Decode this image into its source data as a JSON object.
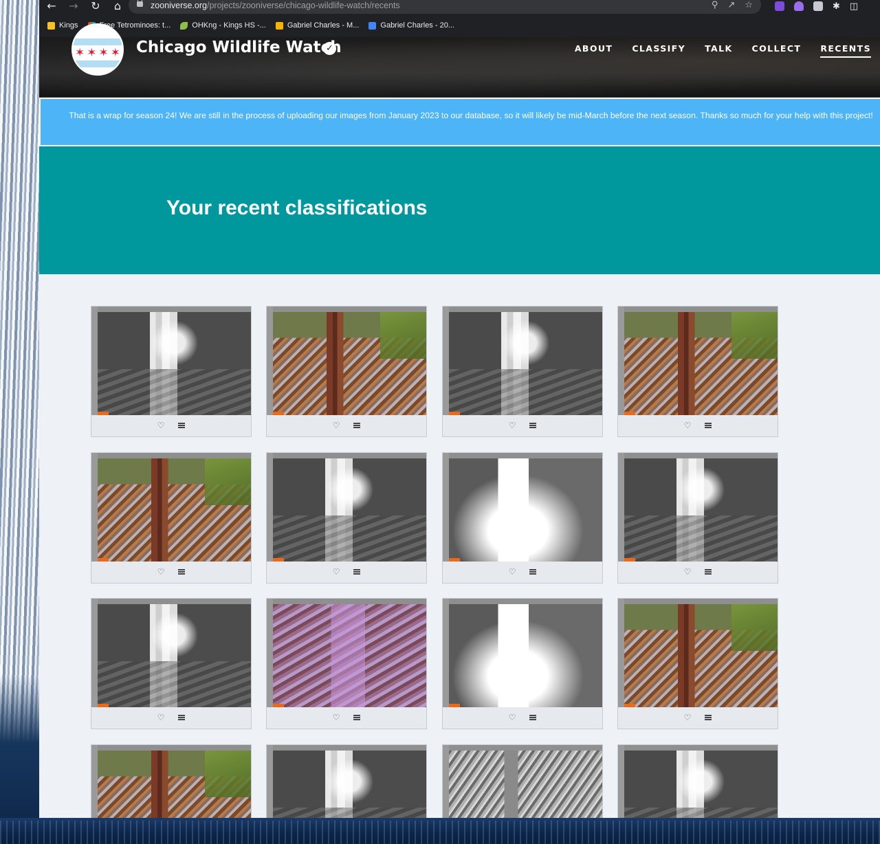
{
  "browser": {
    "url_host": "zooniverse.org",
    "url_path": "/projects/zooniverse/chicago-wildlife-watch/recents",
    "bookmarks": [
      {
        "label": "Kings",
        "icon": "folder-icon"
      },
      {
        "label": "Free Tetrominoes: t...",
        "icon": "tetris-icon"
      },
      {
        "label": "OHKng - Kings HS -...",
        "icon": "leaf-icon"
      },
      {
        "label": "Gabriel Charles - M...",
        "icon": "slides-icon"
      },
      {
        "label": "Gabriel Charles - 20...",
        "icon": "docs-icon"
      }
    ]
  },
  "project": {
    "title": "Chicago Wildlife Watch",
    "nav": [
      {
        "label": "ABOUT",
        "active": false
      },
      {
        "label": "CLASSIFY",
        "active": false
      },
      {
        "label": "TALK",
        "active": false
      },
      {
        "label": "COLLECT",
        "active": false
      },
      {
        "label": "RECENTS",
        "active": true
      }
    ]
  },
  "announcement": "That is a wrap for season 24! We are still in the process of uploading our images from January 2023 to our database, so it will likely be mid-March before the next season. Thanks so much for your help with this project!",
  "hero": {
    "title": "Your recent classifications"
  },
  "recents": [
    {
      "style": "bw"
    },
    {
      "style": "color"
    },
    {
      "style": "bw"
    },
    {
      "style": "color"
    },
    {
      "style": "color"
    },
    {
      "style": "bw"
    },
    {
      "style": "bright"
    },
    {
      "style": "bw"
    },
    {
      "style": "bw"
    },
    {
      "style": "purple"
    },
    {
      "style": "bright"
    },
    {
      "style": "color"
    },
    {
      "style": "color"
    },
    {
      "style": "bw"
    },
    {
      "style": "gray-leaves"
    },
    {
      "style": "bw"
    }
  ],
  "colors": {
    "hero_bg": "#00979d",
    "announcement_bg": "#4cb4f7",
    "orange_tag": "#e86a1a"
  }
}
